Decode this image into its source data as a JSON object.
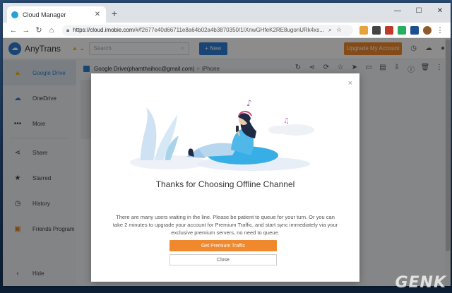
{
  "browser": {
    "tab_title": "Cloud Manager",
    "new_tab": "+",
    "url_host": "https://cloud.imobie.com",
    "url_rest": "/#/f2677e40d66711e8a64b02a4b3870350/1IXnwGHfeK2RE8ugonURk4xs...",
    "controls": {
      "minimize": "—",
      "maximize": "☐",
      "close": "✕"
    }
  },
  "header": {
    "app_name": "AnyTrans",
    "search_placeholder": "Search",
    "new_button": "+ New",
    "upgrade_button": "Upgrade My Account"
  },
  "sidebar": {
    "items": [
      {
        "label": "Google Drive"
      },
      {
        "label": "OneDrive"
      },
      {
        "label": "More"
      },
      {
        "label": "Share"
      },
      {
        "label": "Starred"
      },
      {
        "label": "History"
      },
      {
        "label": "Friends Program"
      },
      {
        "label": "Hide"
      }
    ]
  },
  "breadcrumb": {
    "root": "Google Drive(phamthaihoc@gmail.com)",
    "separator": ">",
    "current": "iPhone"
  },
  "modal": {
    "close_glyph": "×",
    "title": "Thanks for Choosing Offline Channel",
    "description": "There are many users waiting in the line. Please be patient to queue for your turn. Or you can take 2 minutes to upgrade your account for Premium Traffic, and start sync immediately via your exclusive premium servers, no need to queue.",
    "primary_button": "Get Premium Traffic",
    "secondary_button": "Close"
  },
  "watermark": "GENK",
  "colors": {
    "accent_blue": "#2f7fd8",
    "accent_orange": "#f0892d"
  }
}
